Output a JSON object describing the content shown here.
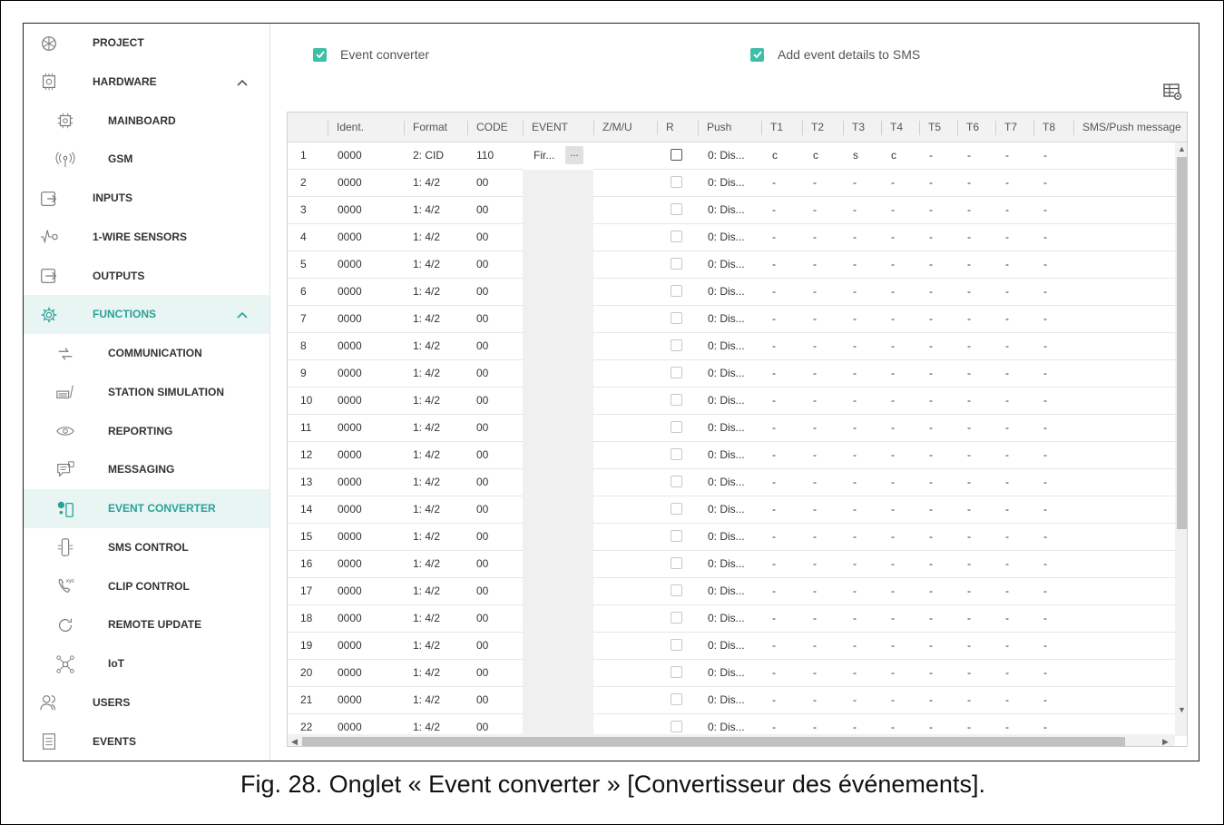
{
  "sidebar": {
    "items": [
      {
        "label": "PROJECT",
        "icon": "project-icon",
        "level": "top"
      },
      {
        "label": "HARDWARE",
        "icon": "hardware-icon",
        "level": "top",
        "expanded": true
      },
      {
        "label": "MAINBOARD",
        "icon": "mainboard-icon",
        "level": "sub"
      },
      {
        "label": "GSM",
        "icon": "gsm-antenna-icon",
        "level": "sub"
      },
      {
        "label": "INPUTS",
        "icon": "inputs-icon",
        "level": "top"
      },
      {
        "label": "1-WIRE SENSORS",
        "icon": "sensor-icon",
        "level": "top"
      },
      {
        "label": "OUTPUTS",
        "icon": "outputs-icon",
        "level": "top"
      },
      {
        "label": "FUNCTIONS",
        "icon": "gear-icon",
        "level": "top",
        "expanded": true
      },
      {
        "label": "COMMUNICATION",
        "icon": "communication-icon",
        "level": "sub"
      },
      {
        "label": "STATION SIMULATION",
        "icon": "station-icon",
        "level": "sub"
      },
      {
        "label": "REPORTING",
        "icon": "eye-icon",
        "level": "sub"
      },
      {
        "label": "MESSAGING",
        "icon": "message-icon",
        "level": "sub"
      },
      {
        "label": "EVENT CONVERTER",
        "icon": "event-converter-icon",
        "level": "sub",
        "selected": true
      },
      {
        "label": "SMS CONTROL",
        "icon": "sms-control-icon",
        "level": "sub"
      },
      {
        "label": "CLIP CONTROL",
        "icon": "clip-control-icon",
        "level": "sub"
      },
      {
        "label": "REMOTE UPDATE",
        "icon": "refresh-icon",
        "level": "sub"
      },
      {
        "label": "IoT",
        "icon": "iot-icon",
        "level": "sub"
      },
      {
        "label": "USERS",
        "icon": "users-icon",
        "level": "top"
      },
      {
        "label": "EVENTS",
        "icon": "events-icon",
        "level": "top"
      }
    ]
  },
  "options": {
    "event_converter_label": "Event converter",
    "event_converter_checked": true,
    "add_details_label": "Add event details to SMS",
    "add_details_checked": true
  },
  "table": {
    "headers": [
      "",
      "Ident.",
      "Format",
      "CODE",
      "EVENT",
      "Z/M/U",
      "R",
      "Push",
      "T1",
      "T2",
      "T3",
      "T4",
      "T5",
      "T6",
      "T7",
      "T8",
      "SMS/Push message"
    ],
    "rows": [
      [
        "1",
        "0000",
        "2: CID",
        "110",
        "Fir...",
        "",
        "",
        "0: Dis...",
        "c",
        "c",
        "s",
        "c",
        "-",
        "-",
        "-",
        "-",
        ""
      ],
      [
        "2",
        "0000",
        "1: 4/2",
        "00",
        "",
        "",
        "",
        "0: Dis...",
        "-",
        "-",
        "-",
        "-",
        "-",
        "-",
        "-",
        "-",
        ""
      ],
      [
        "3",
        "0000",
        "1: 4/2",
        "00",
        "",
        "",
        "",
        "0: Dis...",
        "-",
        "-",
        "-",
        "-",
        "-",
        "-",
        "-",
        "-",
        ""
      ],
      [
        "4",
        "0000",
        "1: 4/2",
        "00",
        "",
        "",
        "",
        "0: Dis...",
        "-",
        "-",
        "-",
        "-",
        "-",
        "-",
        "-",
        "-",
        ""
      ],
      [
        "5",
        "0000",
        "1: 4/2",
        "00",
        "",
        "",
        "",
        "0: Dis...",
        "-",
        "-",
        "-",
        "-",
        "-",
        "-",
        "-",
        "-",
        ""
      ],
      [
        "6",
        "0000",
        "1: 4/2",
        "00",
        "",
        "",
        "",
        "0: Dis...",
        "-",
        "-",
        "-",
        "-",
        "-",
        "-",
        "-",
        "-",
        ""
      ],
      [
        "7",
        "0000",
        "1: 4/2",
        "00",
        "",
        "",
        "",
        "0: Dis...",
        "-",
        "-",
        "-",
        "-",
        "-",
        "-",
        "-",
        "-",
        ""
      ],
      [
        "8",
        "0000",
        "1: 4/2",
        "00",
        "",
        "",
        "",
        "0: Dis...",
        "-",
        "-",
        "-",
        "-",
        "-",
        "-",
        "-",
        "-",
        ""
      ],
      [
        "9",
        "0000",
        "1: 4/2",
        "00",
        "",
        "",
        "",
        "0: Dis...",
        "-",
        "-",
        "-",
        "-",
        "-",
        "-",
        "-",
        "-",
        ""
      ],
      [
        "10",
        "0000",
        "1: 4/2",
        "00",
        "",
        "",
        "",
        "0: Dis...",
        "-",
        "-",
        "-",
        "-",
        "-",
        "-",
        "-",
        "-",
        ""
      ],
      [
        "11",
        "0000",
        "1: 4/2",
        "00",
        "",
        "",
        "",
        "0: Dis...",
        "-",
        "-",
        "-",
        "-",
        "-",
        "-",
        "-",
        "-",
        ""
      ],
      [
        "12",
        "0000",
        "1: 4/2",
        "00",
        "",
        "",
        "",
        "0: Dis...",
        "-",
        "-",
        "-",
        "-",
        "-",
        "-",
        "-",
        "-",
        ""
      ],
      [
        "13",
        "0000",
        "1: 4/2",
        "00",
        "",
        "",
        "",
        "0: Dis...",
        "-",
        "-",
        "-",
        "-",
        "-",
        "-",
        "-",
        "-",
        ""
      ],
      [
        "14",
        "0000",
        "1: 4/2",
        "00",
        "",
        "",
        "",
        "0: Dis...",
        "-",
        "-",
        "-",
        "-",
        "-",
        "-",
        "-",
        "-",
        ""
      ],
      [
        "15",
        "0000",
        "1: 4/2",
        "00",
        "",
        "",
        "",
        "0: Dis...",
        "-",
        "-",
        "-",
        "-",
        "-",
        "-",
        "-",
        "-",
        ""
      ],
      [
        "16",
        "0000",
        "1: 4/2",
        "00",
        "",
        "",
        "",
        "0: Dis...",
        "-",
        "-",
        "-",
        "-",
        "-",
        "-",
        "-",
        "-",
        ""
      ],
      [
        "17",
        "0000",
        "1: 4/2",
        "00",
        "",
        "",
        "",
        "0: Dis...",
        "-",
        "-",
        "-",
        "-",
        "-",
        "-",
        "-",
        "-",
        ""
      ],
      [
        "18",
        "0000",
        "1: 4/2",
        "00",
        "",
        "",
        "",
        "0: Dis...",
        "-",
        "-",
        "-",
        "-",
        "-",
        "-",
        "-",
        "-",
        ""
      ],
      [
        "19",
        "0000",
        "1: 4/2",
        "00",
        "",
        "",
        "",
        "0: Dis...",
        "-",
        "-",
        "-",
        "-",
        "-",
        "-",
        "-",
        "-",
        ""
      ],
      [
        "20",
        "0000",
        "1: 4/2",
        "00",
        "",
        "",
        "",
        "0: Dis...",
        "-",
        "-",
        "-",
        "-",
        "-",
        "-",
        "-",
        "-",
        ""
      ],
      [
        "21",
        "0000",
        "1: 4/2",
        "00",
        "",
        "",
        "",
        "0: Dis...",
        "-",
        "-",
        "-",
        "-",
        "-",
        "-",
        "-",
        "-",
        ""
      ],
      [
        "22",
        "0000",
        "1: 4/2",
        "00",
        "",
        "",
        "",
        "0: Dis...",
        "-",
        "-",
        "-",
        "-",
        "-",
        "-",
        "-",
        "-",
        ""
      ]
    ],
    "event_button_label": "...",
    "r_checked_rows": [
      1
    ]
  },
  "caption": "Fig. 28. Onglet « Event converter » [Convertisseur des événements].",
  "colors": {
    "accent": "#2aa198",
    "checkbox": "#3dbea8",
    "selected_bg": "#e8f5f3"
  }
}
